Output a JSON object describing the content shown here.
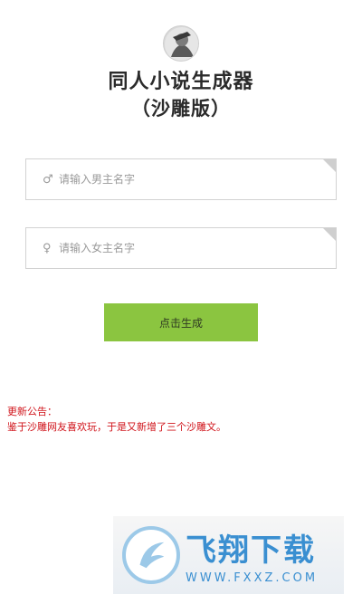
{
  "header": {
    "title": "同人小说生成器",
    "subtitle": "（沙雕版）"
  },
  "form": {
    "male_field": {
      "symbol": "♂",
      "placeholder": "请输入男主名字",
      "value": ""
    },
    "female_field": {
      "symbol": "♀",
      "placeholder": "请输入女主名字",
      "value": ""
    },
    "generate_button": "点击生成"
  },
  "notice": {
    "heading": "更新公告：",
    "body": "鉴于沙雕网友喜欢玩，于是又新增了三个沙雕文。"
  },
  "watermark": {
    "brand_cn": "飞翔下载",
    "brand_url": "WWW.FXXZ.COM"
  },
  "colors": {
    "button_bg": "#8bc540",
    "notice_text": "#d0131a",
    "watermark_blue": "#3a8fd1"
  },
  "icons": {
    "male": "male-symbol-icon",
    "female": "female-symbol-icon",
    "avatar": "avatar-logo-icon",
    "watermark": "watermark-logo-icon"
  }
}
